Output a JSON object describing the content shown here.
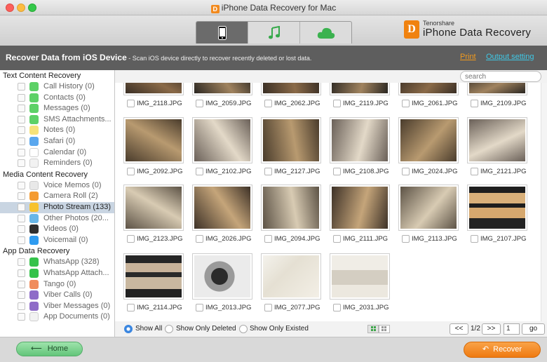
{
  "window": {
    "title": "iPhone Data Recovery for Mac",
    "icon_letter": "D"
  },
  "brand": {
    "logo_letter": "D",
    "company": "Tenorshare",
    "product": "iPhone Data Recovery"
  },
  "tabs": [
    {
      "name": "device-tab",
      "icon": "phone-icon",
      "active": true
    },
    {
      "name": "itunes-tab",
      "icon": "music-note-icon",
      "active": false
    },
    {
      "name": "icloud-tab",
      "icon": "cloud-icon",
      "active": false
    }
  ],
  "banner": {
    "title": "Recover Data from iOS Device",
    "subtitle": " - Scan iOS device directly to recover recently deleted or lost data.",
    "print": "Print",
    "output_setting": "Output setting"
  },
  "search": {
    "placeholder": "search"
  },
  "sidebar": {
    "sections": [
      {
        "title": "Text Content Recovery",
        "items": [
          {
            "label": "Call History (0)",
            "icon": "phone-icon",
            "color": "#5dd167"
          },
          {
            "label": "Contacts (0)",
            "icon": "contacts-icon",
            "color": "#5dd167"
          },
          {
            "label": "Messages (0)",
            "icon": "messages-icon",
            "color": "#5dd167"
          },
          {
            "label": "SMS Attachments...",
            "icon": "attachment-icon",
            "color": "#5dd167"
          },
          {
            "label": "Notes (0)",
            "icon": "notes-icon",
            "color": "#f6e27a"
          },
          {
            "label": "Safari (0)",
            "icon": "safari-icon",
            "color": "#5aa7ee"
          },
          {
            "label": "Calendar (0)",
            "icon": "calendar-icon",
            "color": "#ffffff"
          },
          {
            "label": "Reminders (0)",
            "icon": "reminders-icon",
            "color": "#f2f2f2"
          }
        ]
      },
      {
        "title": "Media Content Recovery",
        "items": [
          {
            "label": "Voice Memos (0)",
            "icon": "voice-memo-icon",
            "color": "#e8e8e8"
          },
          {
            "label": "Camera Roll (2)",
            "icon": "camera-roll-icon",
            "color": "#f49b31"
          },
          {
            "label": "Photo Stream (133)",
            "icon": "photo-stream-icon",
            "color": "#f7c22f"
          },
          {
            "label": "Other Photos (20...",
            "icon": "photos-icon",
            "color": "#68b6e7"
          },
          {
            "label": "Videos (0)",
            "icon": "videos-icon",
            "color": "#2f2f2f"
          },
          {
            "label": "Voicemail (0)",
            "icon": "voicemail-icon",
            "color": "#2f9bf0"
          }
        ]
      },
      {
        "title": "App Data Recovery",
        "items": [
          {
            "label": "WhatsApp (328)",
            "icon": "whatsapp-icon",
            "color": "#34c24a"
          },
          {
            "label": "WhatsApp Attach...",
            "icon": "whatsapp-icon",
            "color": "#34c24a"
          },
          {
            "label": "Tango (0)",
            "icon": "tango-icon",
            "color": "#f08d5c"
          },
          {
            "label": "Viber Calls (0)",
            "icon": "viber-icon",
            "color": "#8f6cc8"
          },
          {
            "label": "Viber Messages (0)",
            "icon": "viber-icon",
            "color": "#8f6cc8"
          },
          {
            "label": "App Documents (0)",
            "icon": "documents-icon",
            "color": "#f2f2f2"
          }
        ]
      }
    ],
    "selected": "Photo Stream (133)"
  },
  "photos": {
    "rows": [
      [
        "IMG_2118.JPG",
        "IMG_2059.JPG",
        "IMG_2062.JPG",
        "IMG_2119.JPG",
        "IMG_2061.JPG",
        "IMG_2109.JPG"
      ],
      [
        "IMG_2092.JPG",
        "IMG_2102.JPG",
        "IMG_2127.JPG",
        "IMG_2108.JPG",
        "IMG_2024.JPG",
        "IMG_2121.JPG"
      ],
      [
        "IMG_2123.JPG",
        "IMG_2026.JPG",
        "IMG_2094.JPG",
        "IMG_2111.JPG",
        "IMG_2113.JPG",
        "IMG_2107.JPG"
      ],
      [
        "IMG_2114.JPG",
        "IMG_2013.JPG",
        "IMG_2077.JPG",
        "IMG_2031.JPG"
      ]
    ]
  },
  "filters": {
    "show_all": "Show All",
    "show_deleted": "Show Only Deleted",
    "show_existed": "Show Only Existed",
    "selected": "Show All"
  },
  "pagination": {
    "prev": "<<",
    "page": "1/2",
    "next": ">>",
    "input": "1",
    "go": "go"
  },
  "footer": {
    "home": "Home",
    "recover": "Recover"
  }
}
